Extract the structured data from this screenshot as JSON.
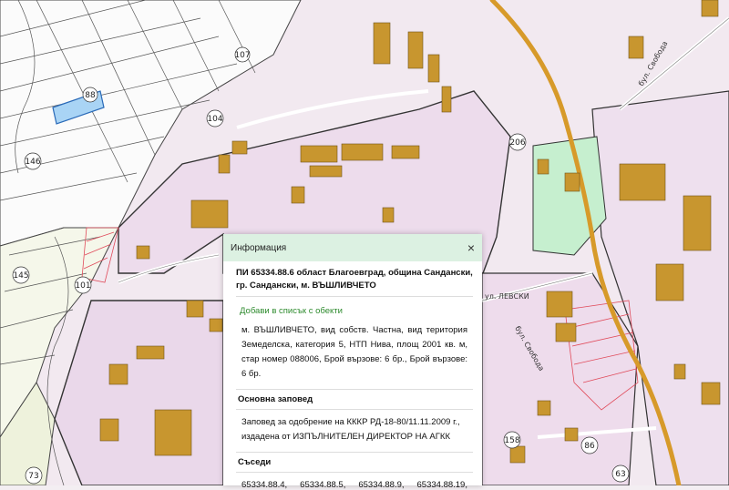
{
  "map": {
    "parcel_labels": [
      "107",
      "88",
      "104",
      "146",
      "145",
      "101",
      "73",
      "206",
      "158",
      "86",
      "63"
    ],
    "street_labels": [
      "бул. Свобода",
      "ул. ЛЕВСКИ",
      "бул. Свобода"
    ]
  },
  "popup": {
    "title": "Информация",
    "close_label": "×",
    "parcel_heading": "ПИ 65334.88.6 област Благоевград, община Сандански, гр. Сандански, м. ВЪШЛИВЧЕТО",
    "add_link": "Добави в списък с обекти",
    "description": "м. ВЪШЛИВЧЕТО, вид собств. Частна, вид територия Земеделска, категория 5, НТП Нива, площ 2001 кв. м, стар номер 088006, Брой вързове: 6 бр., Брой вързове: 6 бр.",
    "order_heading": "Основна заповед",
    "order_text": "Заповед за одобрение на КККР РД-18-80/11.11.2009 г., издадена от ИЗПЪЛНИТЕЛЕН ДИРЕКТОР НА АГКК",
    "neighbors_heading": "Съседи",
    "neighbors": [
      "65334.88.4,",
      "65334.88.5,",
      "65334.88.9,",
      "65334.88.19,"
    ]
  }
}
